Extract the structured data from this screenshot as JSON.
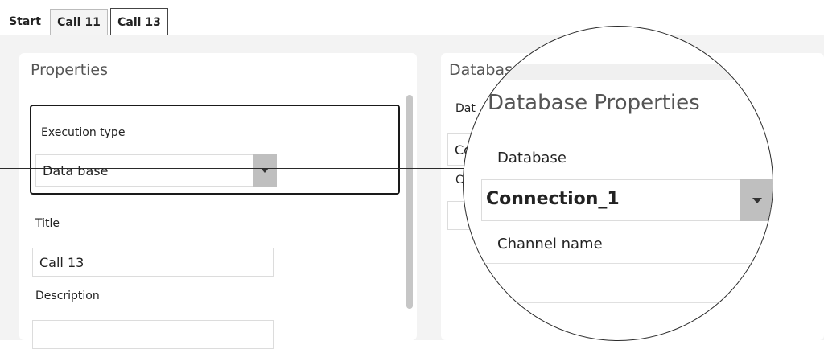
{
  "tabs": [
    {
      "label": "Start",
      "active": false
    },
    {
      "label": "Call 11",
      "active": false
    },
    {
      "label": "Call 13",
      "active": true
    }
  ],
  "properties_panel": {
    "heading": "Properties",
    "execution_type": {
      "label": "Execution type",
      "value": "Data base"
    },
    "title": {
      "label": "Title",
      "value": "Call 13"
    },
    "description": {
      "label": "Description",
      "value": ""
    }
  },
  "database_panel": {
    "heading_partial": "Databas",
    "database_label_partial": "Dat",
    "connection_partial": "Co",
    "channel_label_partial": "C"
  },
  "magnifier": {
    "heading": "Database Properties",
    "database_label": "Database",
    "database_value": "Connection_1",
    "channel_label": "Channel name",
    "channel_value": ""
  },
  "icons": {
    "dropdown": "chevron-down-icon"
  },
  "colors": {
    "tab_active_border": "#444444",
    "panel_bg": "#ffffff",
    "workarea_bg": "#f3f3f3",
    "dropdown_button": "#bfbfbf",
    "highlight_border": "#1a1a1a"
  }
}
